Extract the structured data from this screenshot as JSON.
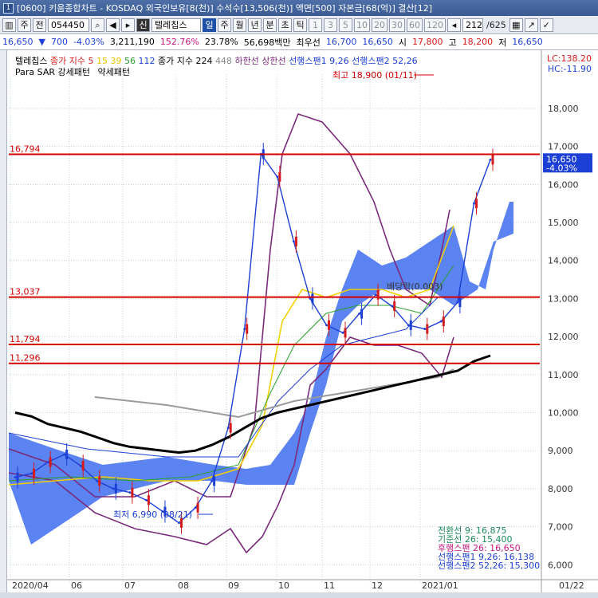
{
  "window": {
    "icon": "1",
    "title": "[0600] 키움종합차트 - KOSDAQ 외국인보유[8(천)] 수석수[13,506(천)] 액면[500] 자본금[68(억)] 결산[12]"
  },
  "toolbar": {
    "buttons": [
      "주",
      "전"
    ],
    "code": "054450",
    "name_prefix": "신",
    "stock_name": "텔레칩스",
    "periods": [
      "일",
      "주",
      "월",
      "년",
      "분",
      "초",
      "틱"
    ],
    "selected_period": "일",
    "intervals": [
      "1",
      "3",
      "5",
      "10",
      "20",
      "30",
      "60",
      "120"
    ],
    "page_current": "212",
    "page_total": "/625"
  },
  "quote": {
    "price": "16,650",
    "change_arrow": "▼",
    "change": "700",
    "change_pct": "-4.03%",
    "volume": "3,211,190",
    "volume_ratio": "152.76%",
    "turnover": "23.78%",
    "trade_value": "56,698백만",
    "best_bid_label": "최우선",
    "best_bid": "16,700",
    "best_ask": "16,650",
    "open_label": "시",
    "open": "17,800",
    "high_label": "고",
    "high": "18,200",
    "low_label": "저",
    "low": "16,650"
  },
  "legend": {
    "stock": "텔레칩스",
    "ma_label": "종가 지수",
    "ma_periods": [
      "5",
      "15",
      "39",
      "56",
      "112"
    ],
    "ma_colors": [
      "#d41c1c",
      "#e8c600",
      "#2aa12a",
      "#1c3fd6",
      "#7a2a7a"
    ],
    "long_ma_label": "종가 지수 224",
    "long_ma_extra": "448",
    "bands": [
      "하한선",
      "상한선"
    ],
    "span1_label": "선행스팬1 9,26",
    "span2_label": "선행스팬2 52,26",
    "sar_label": "Para SAR 강세패턴",
    "sar_weak": "약세패턴",
    "lc": "LC:138.20",
    "hc": "HC:-11.90"
  },
  "annotations": {
    "high_note": "최고 18,900 (01/11)",
    "low_note": "최저 6,990 (08/21)",
    "dividend": "배당락(0.003)"
  },
  "price_lines": [
    {
      "label": "16,794",
      "value": 16794
    },
    {
      "label": "13,037",
      "value": 13037
    },
    {
      "label": "11,794",
      "value": 11794
    },
    {
      "label": "11,296",
      "value": 11296
    }
  ],
  "current_price_box": {
    "price": "16,650",
    "pct": "-4.03%"
  },
  "ichimoku_values": [
    {
      "text": "전환선 9: 16,875",
      "color": "#1b8a5a"
    },
    {
      "text": "기준선 26: 15,400",
      "color": "#1b8a5a"
    },
    {
      "text": "후행스팬 26: 16,650",
      "color": "#c8187f"
    },
    {
      "text": "선행스팬1 9,26: 16,138",
      "color": "#1c3fd6"
    },
    {
      "text": "선행스팬2 52,26: 15,300",
      "color": "#1c3fd6"
    }
  ],
  "chart_data": {
    "type": "line",
    "title": "",
    "x_ticks": [
      "2020/04",
      "06",
      "07",
      "08",
      "09",
      "10",
      "11",
      "12",
      "2021/01",
      "01/22"
    ],
    "y_ticks": [
      6000,
      7000,
      8000,
      9000,
      10000,
      11000,
      12000,
      13000,
      14000,
      15000,
      16000,
      17000,
      18000
    ],
    "ylim": [
      5650,
      18900
    ],
    "series": [
      {
        "name": "종가",
        "color": "#1c3fd6",
        "values": [
          8300,
          8400,
          8700,
          8900,
          8600,
          8200,
          8000,
          7900,
          7700,
          7400,
          7100,
          7500,
          8200,
          9600,
          12200,
          16800,
          16200,
          14500,
          13000,
          12300,
          12100,
          12600,
          13100,
          12800,
          12300,
          12200,
          12400,
          12900,
          15500,
          16650
        ]
      },
      {
        "name": "종가 지수 224",
        "color": "#000000",
        "values": [
          10000,
          9900,
          9700,
          9600,
          9500,
          9350,
          9200,
          9100,
          9050,
          9000,
          8950,
          9000,
          9150,
          9350,
          9600,
          9850,
          10000,
          10100,
          10200,
          10300,
          10400,
          10500,
          10600,
          10700,
          10800,
          10900,
          11000,
          11100,
          11350,
          11500
        ]
      }
    ],
    "grid": true,
    "legend_position": "top-left"
  }
}
